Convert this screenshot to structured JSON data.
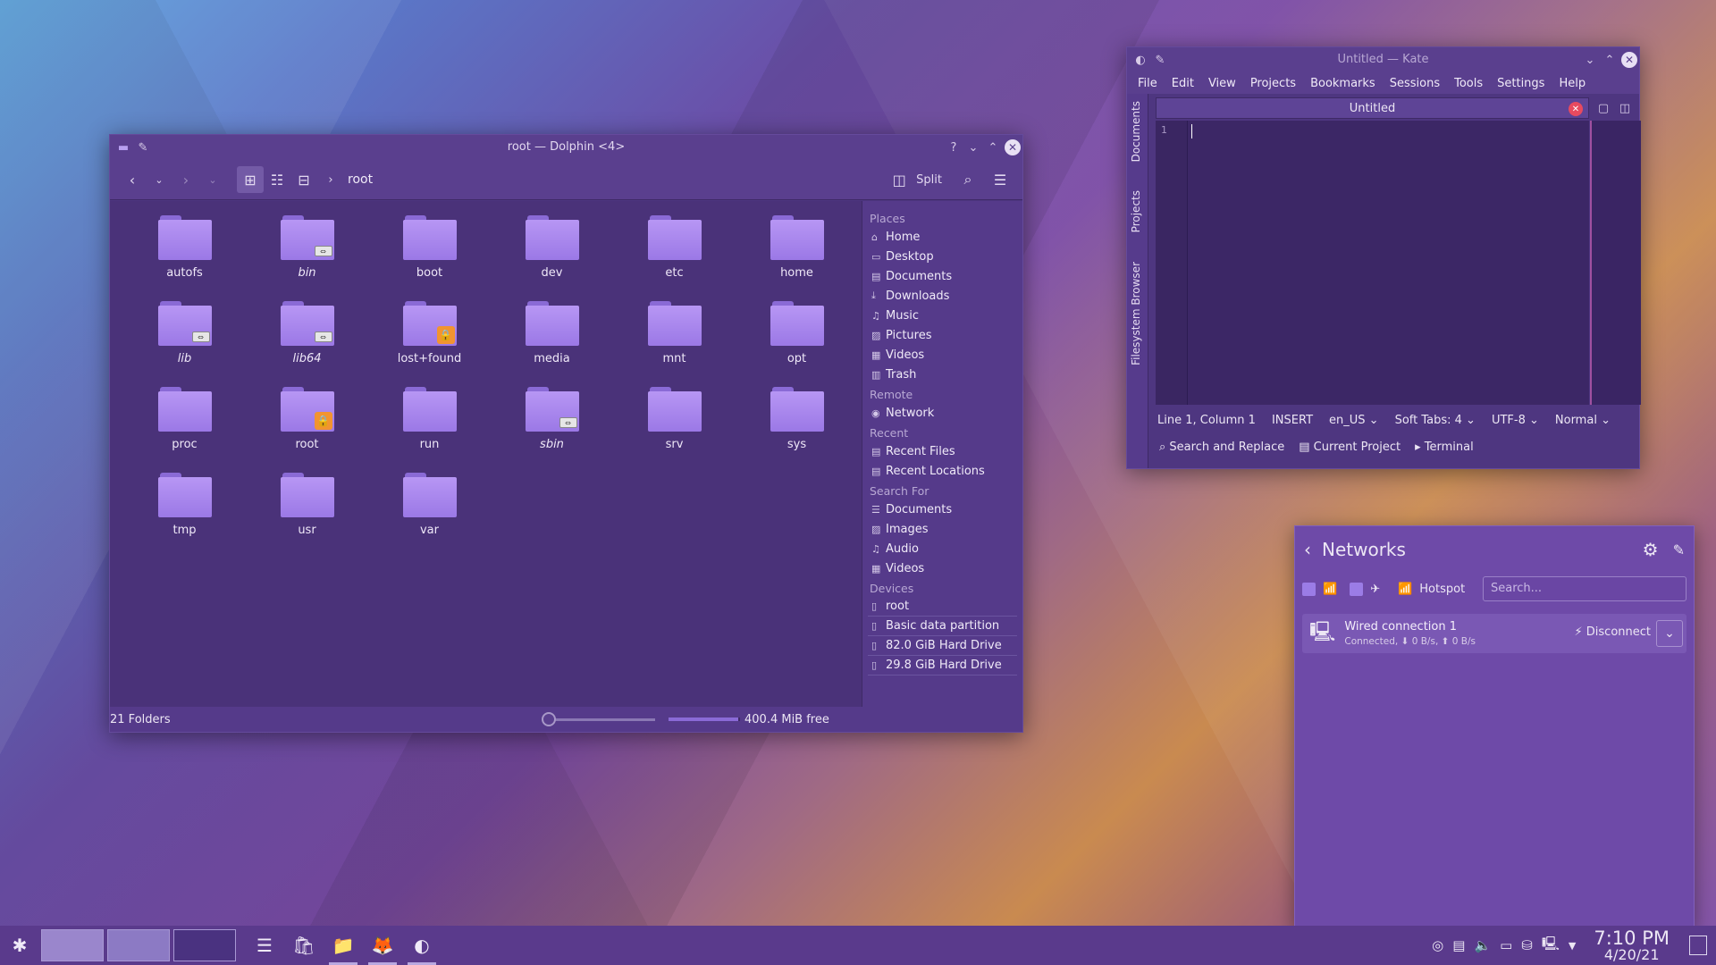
{
  "dolphin": {
    "title": "root — Dolphin <4>",
    "breadcrumb": "root",
    "split_label": "Split",
    "folders": [
      {
        "name": "autofs",
        "italic": false,
        "badge": ""
      },
      {
        "name": "bin",
        "italic": true,
        "badge": "link"
      },
      {
        "name": "boot",
        "italic": false,
        "badge": ""
      },
      {
        "name": "dev",
        "italic": false,
        "badge": ""
      },
      {
        "name": "etc",
        "italic": false,
        "badge": ""
      },
      {
        "name": "home",
        "italic": false,
        "badge": ""
      },
      {
        "name": "lib",
        "italic": true,
        "badge": "link"
      },
      {
        "name": "lib64",
        "italic": true,
        "badge": "link"
      },
      {
        "name": "lost+found",
        "italic": false,
        "badge": "lock"
      },
      {
        "name": "media",
        "italic": false,
        "badge": ""
      },
      {
        "name": "mnt",
        "italic": false,
        "badge": ""
      },
      {
        "name": "opt",
        "italic": false,
        "badge": ""
      },
      {
        "name": "proc",
        "italic": false,
        "badge": ""
      },
      {
        "name": "root",
        "italic": false,
        "badge": "lock"
      },
      {
        "name": "run",
        "italic": false,
        "badge": ""
      },
      {
        "name": "sbin",
        "italic": true,
        "badge": "link"
      },
      {
        "name": "srv",
        "italic": false,
        "badge": ""
      },
      {
        "name": "sys",
        "italic": false,
        "badge": ""
      },
      {
        "name": "tmp",
        "italic": false,
        "badge": ""
      },
      {
        "name": "usr",
        "italic": false,
        "badge": ""
      },
      {
        "name": "var",
        "italic": false,
        "badge": ""
      }
    ],
    "places": {
      "places_header": "Places",
      "places": [
        {
          "label": "Home",
          "icon": "⌂"
        },
        {
          "label": "Desktop",
          "icon": "▭"
        },
        {
          "label": "Documents",
          "icon": "▤"
        },
        {
          "label": "Downloads",
          "icon": "⤓"
        },
        {
          "label": "Music",
          "icon": "♫"
        },
        {
          "label": "Pictures",
          "icon": "▨"
        },
        {
          "label": "Videos",
          "icon": "▦"
        },
        {
          "label": "Trash",
          "icon": "▥"
        }
      ],
      "remote_header": "Remote",
      "remote": [
        {
          "label": "Network",
          "icon": "◉"
        }
      ],
      "recent_header": "Recent",
      "recent": [
        {
          "label": "Recent Files",
          "icon": "▤"
        },
        {
          "label": "Recent Locations",
          "icon": "▤"
        }
      ],
      "search_header": "Search For",
      "search": [
        {
          "label": "Documents",
          "icon": "☰"
        },
        {
          "label": "Images",
          "icon": "▨"
        },
        {
          "label": "Audio",
          "icon": "♫"
        },
        {
          "label": "Videos",
          "icon": "▦"
        }
      ],
      "devices_header": "Devices",
      "devices": [
        {
          "label": "root",
          "icon": "▯"
        },
        {
          "label": "Basic data partition",
          "icon": "▯"
        },
        {
          "label": "82.0 GiB Hard Drive",
          "icon": "▯"
        },
        {
          "label": "29.8 GiB Hard Drive",
          "icon": "▯"
        }
      ]
    },
    "status_count": "21 Folders",
    "free_space": "400.4 MiB free",
    "disk_used_fraction": 0.97
  },
  "kate": {
    "title": "Untitled — Kate",
    "menu": [
      "File",
      "Edit",
      "View",
      "Projects",
      "Bookmarks",
      "Sessions",
      "Tools",
      "Settings",
      "Help"
    ],
    "side_tabs": [
      "Documents",
      "Projects",
      "Filesystem Browser"
    ],
    "tab_title": "Untitled",
    "line_number": "1",
    "status": {
      "position": "Line 1, Column 1",
      "mode": "INSERT",
      "lang": "en_US",
      "tabs": "Soft Tabs: 4",
      "encoding": "UTF-8",
      "input": "Normal"
    },
    "bottom": [
      "Search and Replace",
      "Current Project",
      "Terminal"
    ]
  },
  "networks": {
    "title": "Networks",
    "hotspot_label": "Hotspot",
    "search_placeholder": "Search...",
    "connection_name": "Wired connection 1",
    "connection_status": "Connected, ⬇ 0 B/s, ⬆ 0 B/s",
    "disconnect_label": "Disconnect"
  },
  "taskbar": {
    "time": "7:10 PM",
    "date": "4/20/21"
  }
}
